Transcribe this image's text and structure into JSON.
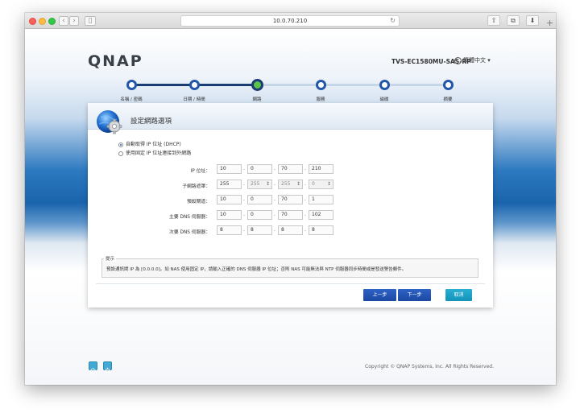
{
  "browser": {
    "url": "10.0.70.210"
  },
  "header": {
    "logo": "QNAP",
    "model": "TVS-EC1580MU-SAS-RP",
    "language": "繁體中文"
  },
  "wizard": {
    "steps": [
      {
        "label": "名稱 / 密碼",
        "state": "done"
      },
      {
        "label": "日期 / 時間",
        "state": "done"
      },
      {
        "label": "網路",
        "state": "active"
      },
      {
        "label": "服務",
        "state": "todo"
      },
      {
        "label": "磁碟",
        "state": "todo"
      },
      {
        "label": "摘要",
        "state": "todo"
      }
    ]
  },
  "panel": {
    "title": "設定網路選項",
    "options": [
      {
        "label": "自動取得 IP 位址 (DHCP)",
        "checked": true
      },
      {
        "label": "使用固定 IP 位址連接到外網路",
        "checked": false
      }
    ],
    "fields": [
      {
        "label": "IP 位址：",
        "octets": [
          "10",
          "0",
          "70",
          "210"
        ]
      },
      {
        "label": "子網路遮罩：",
        "octets": [
          "255",
          "255",
          "255",
          "0"
        ]
      },
      {
        "label": "預設閘道：",
        "octets": [
          "10",
          "0",
          "70",
          "1"
        ]
      },
      {
        "label": "主要 DNS 伺服器：",
        "octets": [
          "10",
          "0",
          "70",
          "102"
        ]
      },
      {
        "label": "次要 DNS 伺服器：",
        "octets": [
          "8",
          "8",
          "8",
          "8"
        ]
      }
    ],
    "hint_title": "提示",
    "hint_text": "預設通訊閘 IP 為 [0.0.0.0]。如 NAS 使用固定 IP，請輸入正確的 DNS 伺服器 IP 位址；否則 NAS 可能無法與 NTP 伺服器同步時間或是發送警告郵件。",
    "buttons": {
      "prev": "上一步",
      "next": "下一步",
      "cancel": "取消"
    }
  },
  "footer": {
    "copyright": "Copyright © QNAP Systems, Inc. All Rights Reserved."
  },
  "colors": {
    "accent": "#1b47a3",
    "active_step": "#5ac34a",
    "cancel": "#1493bb"
  }
}
